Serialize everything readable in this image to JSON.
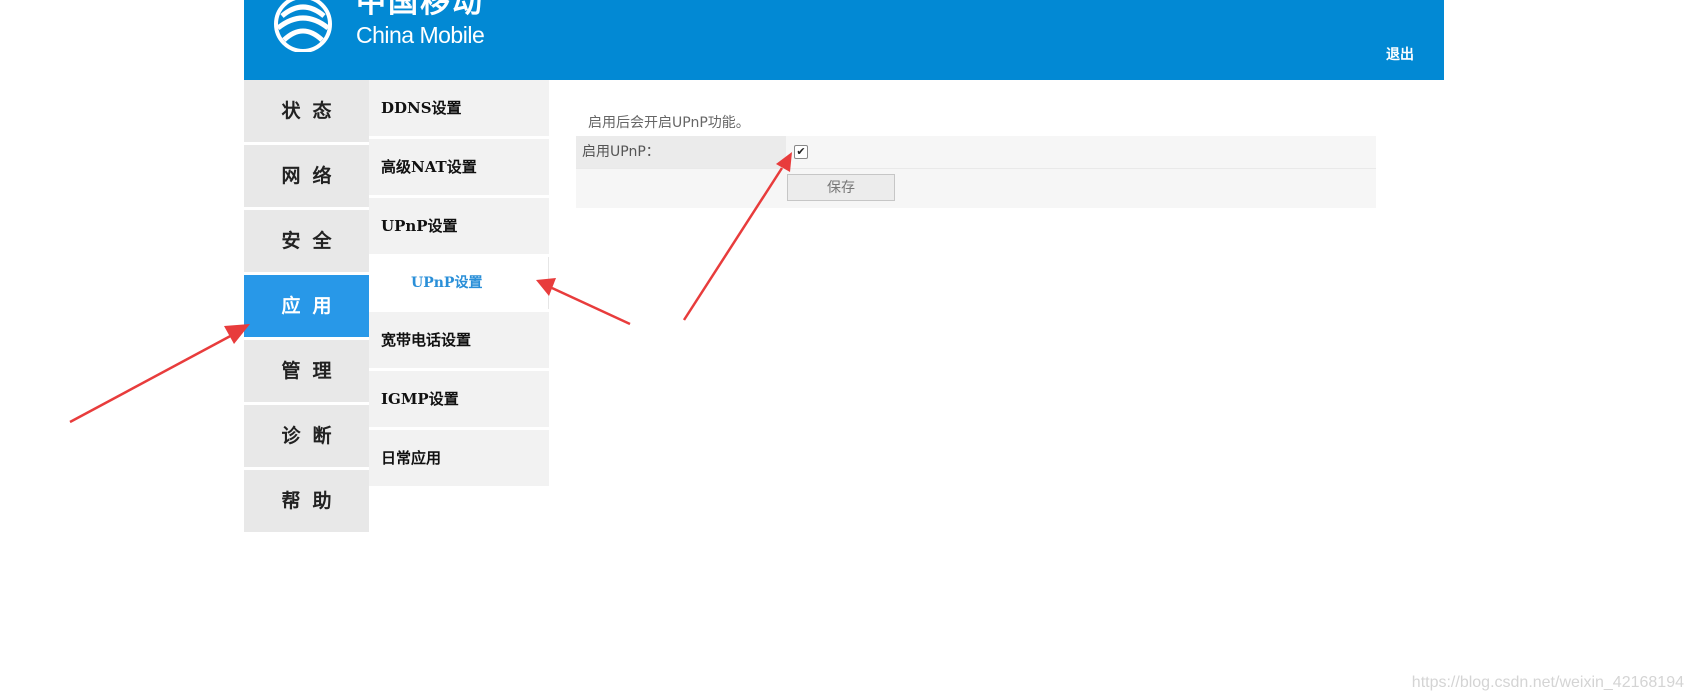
{
  "header": {
    "logo_cn": "中国移动",
    "logo_en": "China Mobile",
    "logout_label": "退出",
    "background_color": "#0289d4"
  },
  "main_nav": {
    "items": [
      {
        "label": "状态",
        "active": false
      },
      {
        "label": "网络",
        "active": false
      },
      {
        "label": "安全",
        "active": false
      },
      {
        "label": "应用",
        "active": true
      },
      {
        "label": "管理",
        "active": false
      },
      {
        "label": "诊断",
        "active": false
      },
      {
        "label": "帮助",
        "active": false
      }
    ],
    "active_color": "#2898e8"
  },
  "sub_nav": {
    "items": [
      {
        "label": "DDNS设置"
      },
      {
        "label": "高级NAT设置"
      },
      {
        "label": "UPnP设置"
      },
      {
        "label": "UPnP设置",
        "child": true,
        "active": true
      },
      {
        "label": "宽带电话设置"
      },
      {
        "label": "IGMP设置"
      },
      {
        "label": "日常应用"
      }
    ],
    "active_color": "#2a8fd8"
  },
  "content": {
    "hint": "启用后会开启UPnP功能。",
    "enable_label": "启用UPnP：",
    "enable_checked": true,
    "save_label": "保存"
  },
  "annotations": {
    "arrow_color": "#e83c3c",
    "arrow_count": 3
  },
  "watermark": "https://blog.csdn.net/weixin_42168194"
}
